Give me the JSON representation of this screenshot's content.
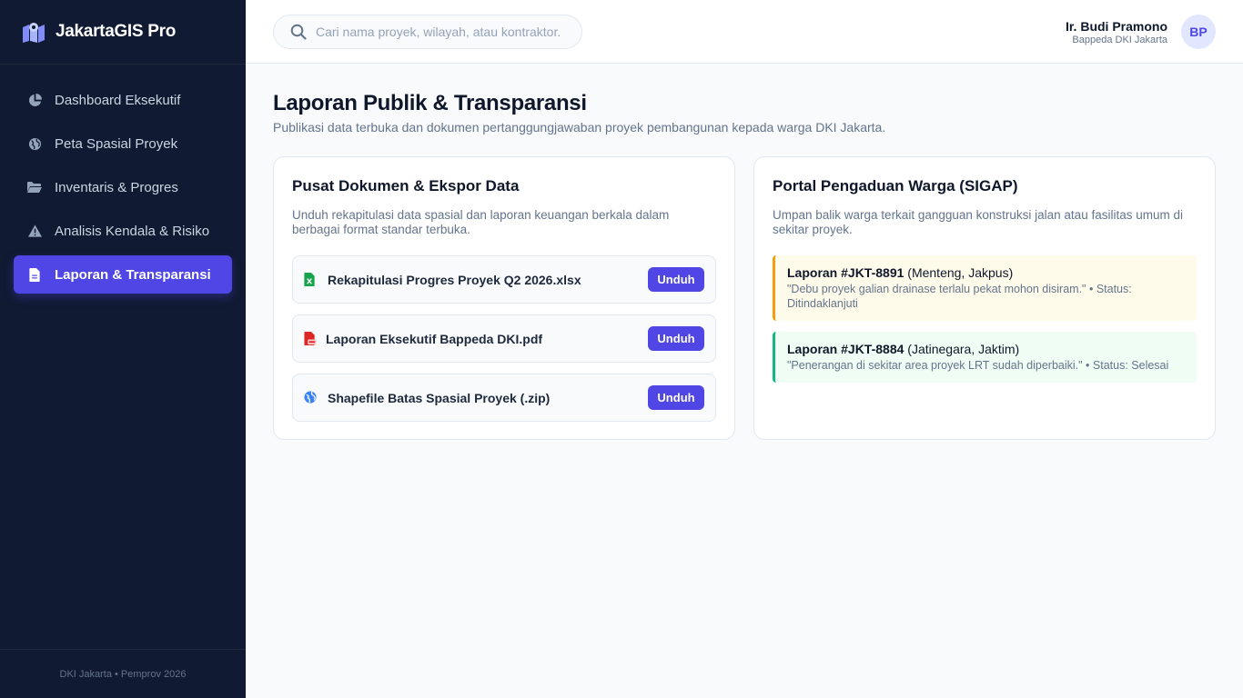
{
  "app": {
    "name": "JakartaGIS Pro",
    "footer": "DKI Jakarta • Pemprov 2026"
  },
  "sidebar": {
    "items": [
      {
        "label": "Dashboard Eksekutif",
        "icon": "pie-chart-icon",
        "active": false
      },
      {
        "label": "Peta Spasial Proyek",
        "icon": "globe-icon",
        "active": false
      },
      {
        "label": "Inventaris & Progres",
        "icon": "folder-icon",
        "active": false
      },
      {
        "label": "Analisis Kendala & Risiko",
        "icon": "warning-icon",
        "active": false
      },
      {
        "label": "Laporan & Transparansi",
        "icon": "document-icon",
        "active": true
      }
    ]
  },
  "header": {
    "search_placeholder": "Cari nama proyek, wilayah, atau kontraktor...",
    "search_value": "",
    "user_name": "Ir. Budi Pramono",
    "user_role": "Bappeda DKI Jakarta",
    "avatar_initials": "BP"
  },
  "page": {
    "title": "Laporan Publik & Transparansi",
    "subtitle": "Publikasi data terbuka dan dokumen pertanggungjawaban proyek pembangunan kepada warga DKI Jakarta."
  },
  "documents": {
    "title": "Pusat Dokumen & Ekspor Data",
    "description": "Unduh rekapitulasi data spasial dan laporan keuangan berkala dalam berbagai format standar terbuka.",
    "items": [
      {
        "name": "Rekapitulasi Progres Proyek Q2 2026.xlsx",
        "icon": "excel-file-icon",
        "button": "Unduh"
      },
      {
        "name": "Laporan Eksekutif Bappeda DKI.pdf",
        "icon": "pdf-file-icon",
        "button": "Unduh"
      },
      {
        "name": "Shapefile Batas Spasial Proyek (.zip)",
        "icon": "globe-icon",
        "button": "Unduh"
      }
    ]
  },
  "complaints": {
    "title": "Portal Pengaduan Warga (SIGAP)",
    "description": "Umpan balik warga terkait gangguan konstruksi jalan atau fasilitas umum di sekitar proyek.",
    "items": [
      {
        "id": "Laporan #JKT-8891",
        "location": "(Menteng, Jakpus)",
        "text": "\"Debu proyek galian drainase terlalu pekat mohon disiram.\" • Status: Ditindaklanjuti",
        "accent": "#f59e0b"
      },
      {
        "id": "Laporan #JKT-8884",
        "location": "(Jatinegara, Jaktim)",
        "text": "\"Penerangan di sekitar area proyek LRT sudah diperbaiki.\" • Status: Selesai",
        "accent": "#10b981"
      }
    ]
  },
  "colors": {
    "sidebar_bg": "#111a33",
    "accent": "#4f46e5",
    "warning": "#f59e0b",
    "success": "#10b981",
    "excel": "#16a34a",
    "pdf": "#dc2626",
    "globe": "#3b82f6"
  }
}
